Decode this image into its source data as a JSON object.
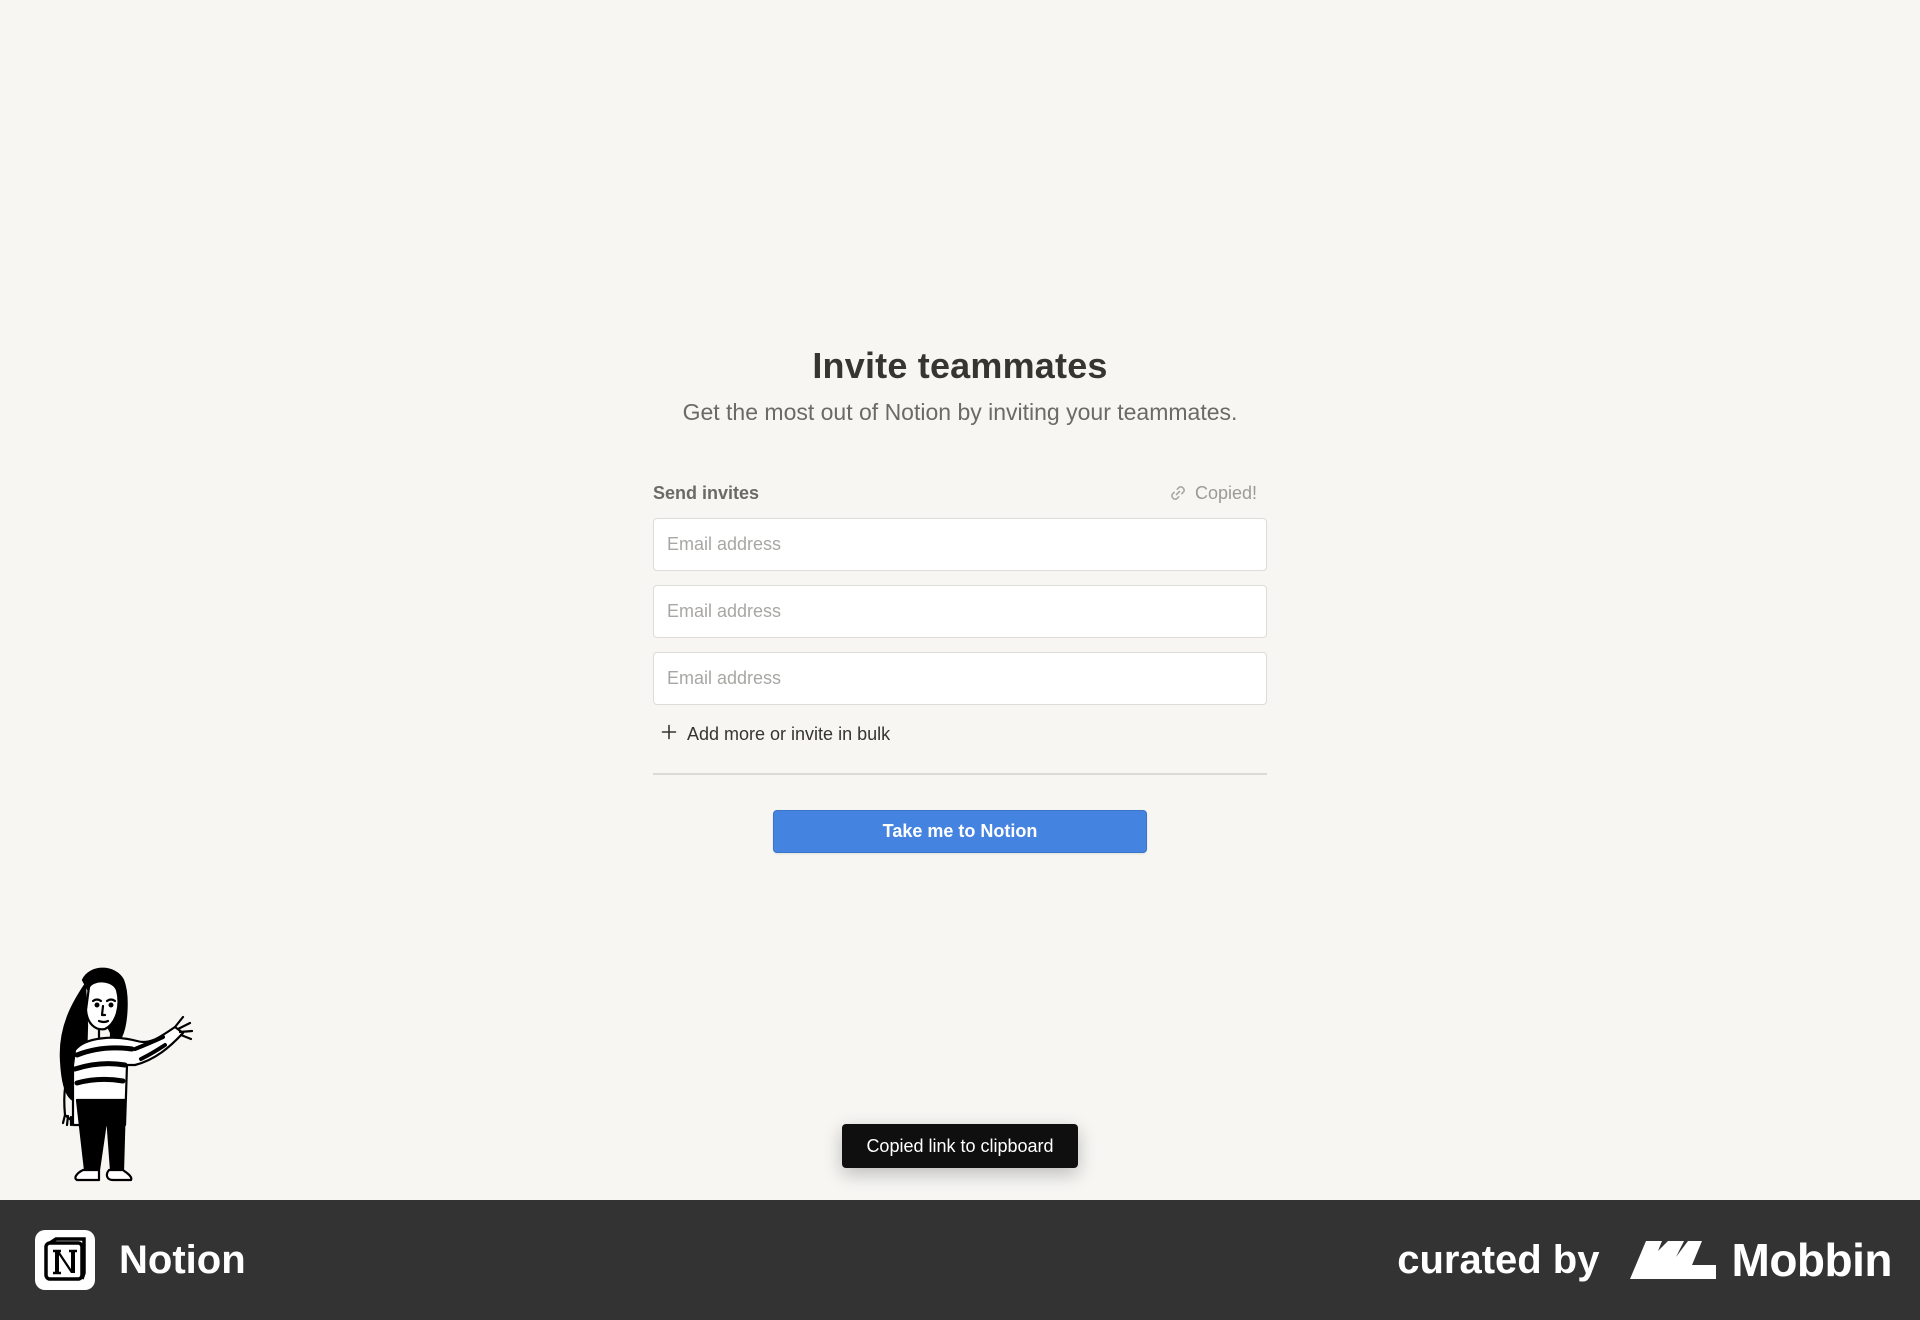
{
  "header": {
    "title": "Invite teammates",
    "subtitle": "Get the most out of Notion by inviting your teammates."
  },
  "invites": {
    "label": "Send invites",
    "copy_link_status": "Copied!",
    "email_placeholder": "Email address",
    "add_more_label": "Add more or invite in bulk"
  },
  "cta": {
    "label": "Take me to Notion",
    "color": "#4483e0"
  },
  "toast": {
    "message": "Copied link to clipboard"
  },
  "footer": {
    "app_name": "Notion",
    "curated_by": "curated by",
    "curator_name": "Mobbin",
    "background": "#333333"
  },
  "icons": {
    "link": "link-icon",
    "plus": "plus-icon",
    "notion_logo": "notion-logo-icon",
    "mobbin_logo": "mobbin-logo-icon"
  }
}
